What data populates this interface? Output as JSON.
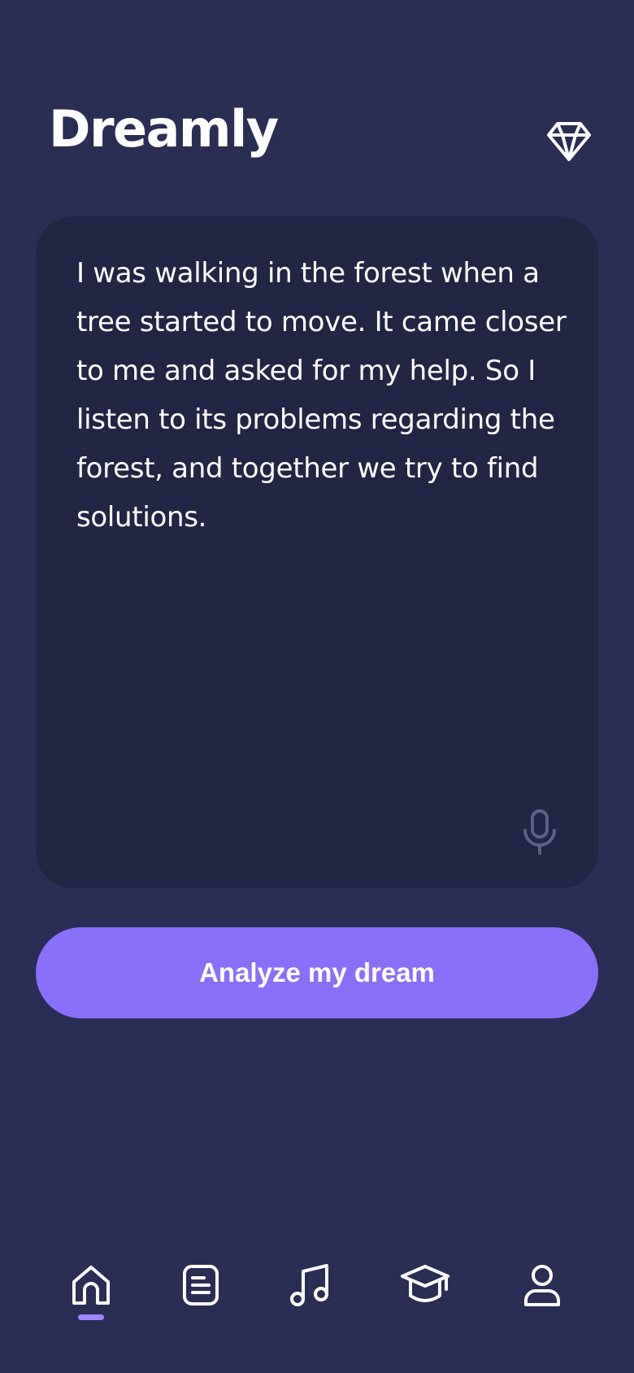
{
  "header": {
    "app_title": "Dreamly",
    "premium_icon": "diamond-icon"
  },
  "dream_input": {
    "text": "I was walking in the forest when a tree started to move. It came closer to me and asked for my help. So I listen to its problems regarding the forest, and together we try to find solutions.",
    "mic_icon": "microphone-icon"
  },
  "actions": {
    "analyze_label": "Analyze my dream"
  },
  "bottom_nav": {
    "items": [
      {
        "icon": "home-icon",
        "active": true
      },
      {
        "icon": "journal-icon",
        "active": false
      },
      {
        "icon": "music-note-icon",
        "active": false
      },
      {
        "icon": "graduation-cap-icon",
        "active": false
      },
      {
        "icon": "profile-icon",
        "active": false
      }
    ]
  },
  "colors": {
    "background": "#2a2e55",
    "card": "#222543",
    "accent": "#8a6ffa",
    "indicator": "#9f86ff",
    "mic_muted": "#5e6185"
  }
}
